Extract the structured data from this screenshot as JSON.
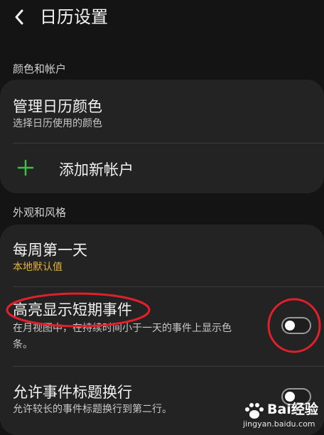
{
  "header": {
    "title": "日历设置",
    "back_icon": "back-arrow-icon"
  },
  "sections": {
    "colors_accounts": {
      "label": "颜色和帐户"
    },
    "appearance": {
      "label": "外观和风格"
    }
  },
  "items": {
    "manage_colors": {
      "title": "管理日历颜色",
      "subtitle": "选择日历使用的颜色"
    },
    "add_account": {
      "label": "添加新帐户",
      "icon": "plus-icon"
    },
    "first_day": {
      "title": "每周第一天",
      "value": "本地默认值"
    },
    "highlight_short": {
      "title": "高亮显示短期事件",
      "subtitle_line1": "在月视图中，在持续时间小于一天的事件上显示色",
      "subtitle_line2": "条。",
      "enabled": false
    },
    "wrap_titles": {
      "title": "允许事件标题换行",
      "subtitle": "允许较长的事件标题换行到第二行。",
      "enabled": false
    }
  },
  "colors": {
    "accent_gold": "#e1b13a",
    "plus_green": "#3fbf4a",
    "annotation_red": "#e0202b",
    "background": "#141414",
    "card": "#232323"
  },
  "watermark": {
    "brand": "Bai",
    "brand2": "经验",
    "url": "jingyan.baidu.com"
  }
}
